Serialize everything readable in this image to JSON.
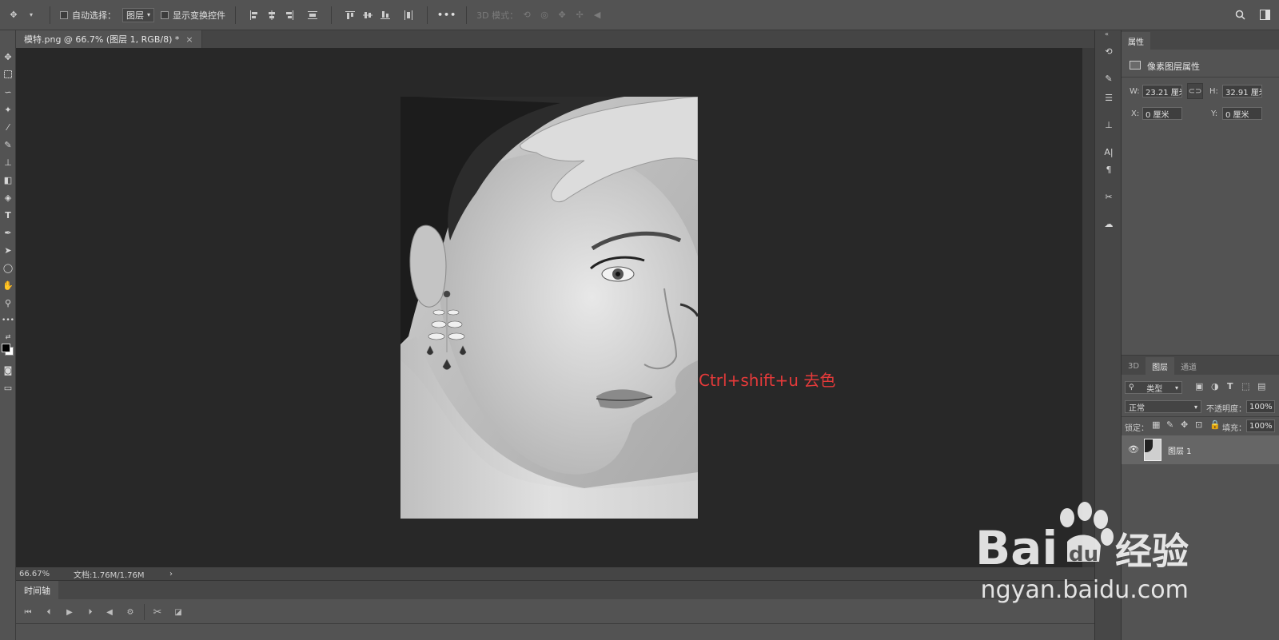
{
  "options_bar": {
    "move_tool_icon": "move-icon",
    "auto_select_label": "自动选择：",
    "auto_select_target": "图层",
    "show_transform_label": "显示变换控件",
    "more_label": "•••",
    "mode_3d_label": "3D 模式："
  },
  "document": {
    "tab_title": "模特.png @ 66.7% (图层 1, RGB/8) *",
    "close_glyph": "×",
    "annotation": "Ctrl+shift+u 去色",
    "annotation_color": "#e53a3a"
  },
  "status_bar": {
    "zoom": "66.67%",
    "doc_info": "文档:1.76M/1.76M",
    "arrow": "›"
  },
  "timeline": {
    "tab_label": "时间轴"
  },
  "properties": {
    "tab_label": "属性",
    "section_title": "像素图层属性",
    "w_label": "W:",
    "w_value": "23.21 厘米",
    "h_label": "H:",
    "h_value": "32.91 厘米",
    "x_label": "X:",
    "x_value": "0 厘米",
    "y_label": "Y:",
    "y_value": "0 厘米"
  },
  "layers_panel": {
    "tabs": [
      "3D",
      "图层",
      "通道"
    ],
    "filter_label": "类型",
    "blend_mode": "正常",
    "opacity_label": "不透明度：",
    "opacity_value": "100%",
    "lock_label": "锁定：",
    "fill_label": "填充：",
    "fill_value": "100%",
    "layer_name": "图层 1"
  },
  "watermark": {
    "brand": "Bai",
    "brand_du": "du",
    "brand_suffix": "经验",
    "url": "jingyan.baidu.com"
  }
}
